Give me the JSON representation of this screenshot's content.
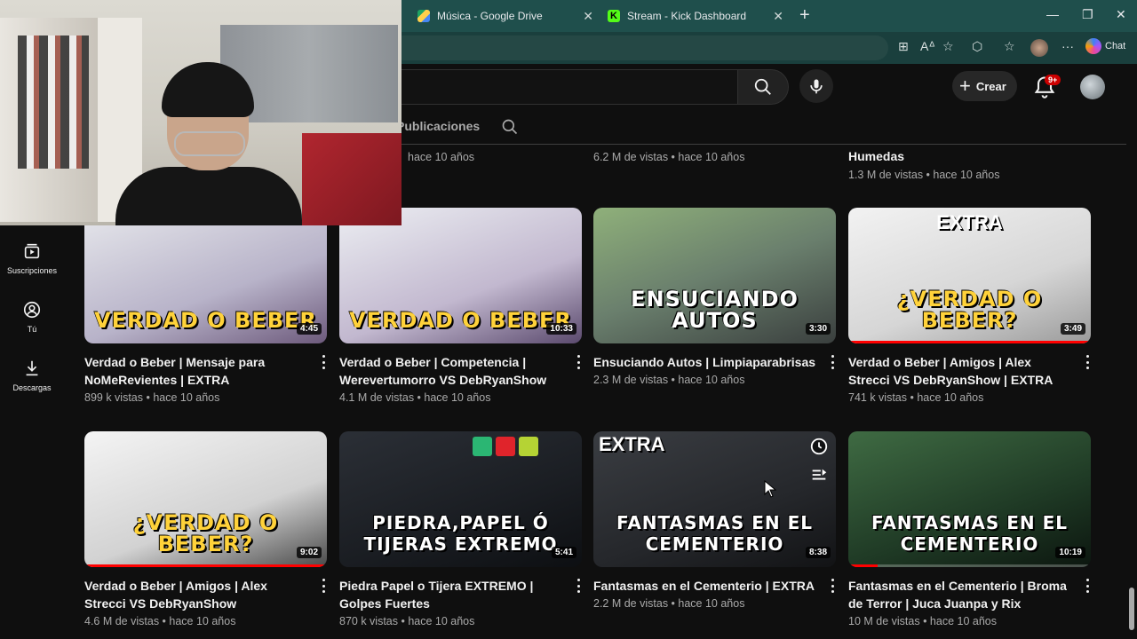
{
  "browser": {
    "tabs": [
      {
        "label": "Música - Google Drive",
        "icon": "google-drive-icon"
      },
      {
        "label": "Stream - Kick Dashboard",
        "icon": "kick-icon"
      }
    ],
    "chat_label": "Chat",
    "notif_count": "9+"
  },
  "header": {
    "create_label": "Crear"
  },
  "channel": {
    "tab_posts": "Publicaciones"
  },
  "sidebar": {
    "items": [
      {
        "label": "Suscripciones",
        "icon": "subscriptions-icon"
      },
      {
        "label": "Tú",
        "icon": "you-icon"
      },
      {
        "label": "Descargas",
        "icon": "download-icon"
      }
    ]
  },
  "top_row": {
    "meta1": "hace 10 años",
    "meta2": "6.2 M de vistas • hace 10 años",
    "title3": "Humedas",
    "meta3": "1.3 M de vistas • hace 10 años"
  },
  "videos": [
    {
      "title": "Verdad o Beber | Mensaje para NoMeRevientes | EXTRA",
      "meta": "899 k vistas • hace 10 años",
      "duration": "4:45",
      "caption": "VERDAD O BEBER"
    },
    {
      "title": "Verdad o Beber | Competencia | Werevertumorro VS DebRyanShow",
      "meta": "4.1 M de vistas • hace 10 años",
      "duration": "10:33",
      "caption": "VERDAD O BEBER"
    },
    {
      "title": "Ensuciando Autos | Limpiaparabrisas",
      "meta": "2.3 M de vistas • hace 10 años",
      "duration": "3:30",
      "caption": "ENSUCIANDO AUTOS"
    },
    {
      "title": "Verdad o Beber | Amigos | Alex Strecci VS DebRyanShow | EXTRA",
      "meta": "741 k vistas • hace 10 años",
      "duration": "3:49",
      "caption": "¿VERDAD O BEBER?",
      "badge": "EXTRA"
    },
    {
      "title": "Verdad o Beber | Amigos | Alex Strecci VS DebRyanShow",
      "meta": "4.6 M de vistas • hace 10 años",
      "duration": "9:02",
      "caption": "¿VERDAD O BEBER?"
    },
    {
      "title": "Piedra Papel o Tijera EXTREMO | Golpes Fuertes",
      "meta": "870 k vistas • hace 10 años",
      "duration": "5:41",
      "caption": "PIEDRA,PAPEL Ó TIJERAS EXTREMO"
    },
    {
      "title": "Fantasmas en el Cementerio | EXTRA",
      "meta": "2.2 M de vistas • hace 10 años",
      "duration": "8:38",
      "caption": "FANTASMAS EN EL CEMENTERIO",
      "badge": "EXTRA"
    },
    {
      "title": "Fantasmas en el Cementerio | Broma de Terror | Juca Juanpa y Rix",
      "meta": "10 M de vistas • hace 10 años",
      "duration": "10:19",
      "caption": "FANTASMAS EN EL CEMENTERIO"
    }
  ],
  "colors": {
    "accent": "#ff0000",
    "tabbar": "#1f4f4c",
    "background": "#0f0f0f"
  }
}
